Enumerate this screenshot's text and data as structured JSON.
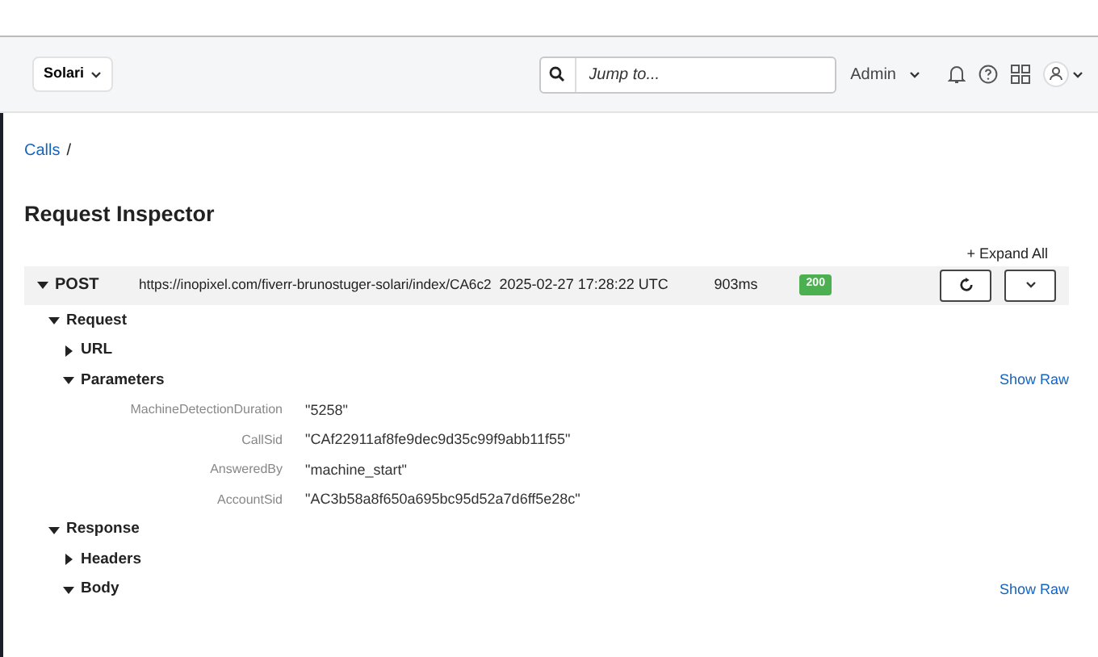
{
  "header": {
    "workspace": "Solari",
    "search_placeholder": "Jump to...",
    "user_menu": "Admin"
  },
  "breadcrumb": {
    "link": "Calls",
    "separator": "/"
  },
  "title": "Request Inspector",
  "expand_all": "+ Expand All",
  "request": {
    "method": "POST",
    "expanded": true,
    "url": "https://inopixel.com/fiverr-brunostuger-solari/index/CA6c2",
    "time": "2025-02-27 17:28:22 UTC",
    "duration": "903ms",
    "status": "200"
  },
  "sections": [
    {
      "label": "Request",
      "expanded": true,
      "children": [
        {
          "label": "URL",
          "expanded": false
        },
        {
          "label": "Parameters",
          "expanded": true,
          "action": "Show Raw",
          "params": [
            {
              "name": "MachineDetectionDuration",
              "value": "\"5258\""
            },
            {
              "name": "CallSid",
              "value": "\"CAf22911af8fe9dec9d35c99f9abb11f55\""
            },
            {
              "name": "AnsweredBy",
              "value": "\"machine_start\""
            },
            {
              "name": "AccountSid",
              "value": "\"AC3b58a8f650a695bc95d52a7d6ff5e28c\""
            }
          ]
        }
      ]
    },
    {
      "label": "Response",
      "expanded": true,
      "children": [
        {
          "label": "Headers",
          "expanded": false
        },
        {
          "label": "Body",
          "expanded": true,
          "action": "Show Raw"
        }
      ]
    }
  ]
}
